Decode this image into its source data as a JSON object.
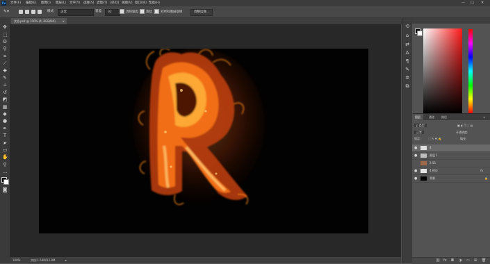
{
  "app": {
    "logo": "Ps",
    "menu": [
      "文件(F)",
      "编辑(E)",
      "图像(I)",
      "图层(L)",
      "文字(Y)",
      "选择(S)",
      "滤镜(T)",
      "3D(D)",
      "视图(V)",
      "窗口(W)",
      "帮助(H)"
    ],
    "window_controls": [
      "—",
      "□",
      "✕"
    ]
  },
  "options_bar": {
    "mode_label": "模式:",
    "mode_value": "正常",
    "opacity_label": "容差:",
    "opacity_value": "32",
    "antialias_label": "消除锯齿",
    "contiguous_label": "连续",
    "sample_all_label": "对所有图层取样",
    "refine_button": "调整边缘..."
  },
  "document": {
    "tab_title": "文档.psd @ 100% (4, RGB/8#)",
    "tab_close": "×"
  },
  "status_bar": {
    "zoom": "100%",
    "doc_info": "文档:1.54M/12.8M"
  },
  "layers_panel": {
    "tabs": [
      "图层",
      "通道",
      "路径"
    ],
    "filter_label": "p 类型",
    "blend_mode": "正常",
    "opacity_label": "不透明度:",
    "lock_label": "锁定:",
    "fill_label": "填充:",
    "layers": [
      {
        "name": "4",
        "visible": true,
        "fx": false,
        "locked": false,
        "selected": true
      },
      {
        "name": "图层 1",
        "visible": true,
        "fx": false,
        "locked": false,
        "selected": false
      },
      {
        "name": "2.55",
        "visible": false,
        "fx": false,
        "locked": false,
        "selected": false
      },
      {
        "name": "4 拷贝",
        "visible": true,
        "fx": true,
        "locked": false,
        "selected": false
      },
      {
        "name": "背景",
        "visible": true,
        "fx": false,
        "locked": true,
        "selected": false
      }
    ],
    "footer_icons": [
      "link-icon",
      "fx-icon",
      "mask-icon",
      "adjustment-icon",
      "folder-icon",
      "new-layer-icon",
      "trash-icon"
    ]
  },
  "colors": {
    "canvas_bg": "#030202",
    "workspace_bg": "#282828",
    "panel_bg": "#535353",
    "fire_core": "#ffb23a",
    "fire_outer": "#c2410c"
  },
  "tools": [
    "move-tool",
    "marquee-tool",
    "lasso-tool",
    "magic-wand-tool",
    "crop-tool",
    "eyedropper-tool",
    "healing-tool",
    "brush-tool",
    "stamp-tool",
    "history-brush-tool",
    "eraser-tool",
    "gradient-tool",
    "blur-tool",
    "dodge-tool",
    "pen-tool",
    "type-tool",
    "path-select-tool",
    "shape-tool",
    "hand-tool",
    "zoom-tool",
    "more-tools",
    "color-swatches",
    "quick-mask",
    "screen-mode"
  ]
}
